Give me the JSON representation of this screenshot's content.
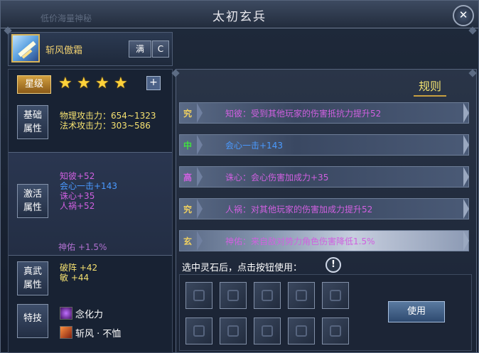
{
  "window": {
    "title": "太初玄兵",
    "watermark": "低价海量神秘"
  },
  "header": {
    "weapon_name": "斩风傲霜",
    "full_label": "满",
    "refresh_symbol": "C"
  },
  "stars": {
    "label": "星级",
    "count": 4,
    "symbol": "★",
    "plus": "+"
  },
  "basic": {
    "tag_line1": "基础",
    "tag_line2": "属性",
    "lines": [
      "物理攻击力：654~1323",
      "法术攻击力：303~586"
    ]
  },
  "activation": {
    "tag_line1": "激活",
    "tag_line2": "属性",
    "lines": [
      {
        "text": "知彼+52",
        "color": "purple"
      },
      {
        "text": "会心一击+143",
        "color": "blue"
      },
      {
        "text": "诛心+35",
        "color": "purple"
      },
      {
        "text": "人祸+52",
        "color": "purple"
      }
    ],
    "shenyou": "神佑 +1.5%"
  },
  "martial": {
    "tag_line1": "真武",
    "tag_line2": "属性",
    "lines": [
      "破阵 +42",
      "敏 +44"
    ]
  },
  "skills": {
    "tag": "特技",
    "items": [
      {
        "name": "念化力",
        "icon": "mind-force-icon"
      },
      {
        "name": "斩风 · 不恤",
        "icon": "wind-slash-icon"
      }
    ]
  },
  "rules": {
    "label": "规则",
    "items": [
      {
        "grade": "究",
        "grade_color": "#f0d060",
        "text": "知彼：受到其他玩家的伤害抵抗力提升52",
        "text_color": "#d060e0"
      },
      {
        "grade": "中",
        "grade_color": "#40e040",
        "text": "会心一击+143",
        "text_color": "#4a9aff"
      },
      {
        "grade": "高",
        "grade_color": "#d060e0",
        "text": "诛心：会心伤害加成力+35",
        "text_color": "#d060e0"
      },
      {
        "grade": "究",
        "grade_color": "#f0d060",
        "text": "人祸：对其他玩家的伤害加成力提升52",
        "text_color": "#d060e0"
      },
      {
        "grade": "玄",
        "grade_color": "#f0d060",
        "text": "神佑：来自敌对势力角色伤害降低1.5%",
        "text_color": "#d060e0"
      }
    ]
  },
  "stones": {
    "hint": "选中灵石后，点击按钮使用：",
    "info_icon": "!",
    "slot_count": 10,
    "use_label": "使用"
  },
  "colors": {
    "accent_gold": "#f0d070",
    "purple": "#d060e0",
    "blue": "#4a9aff"
  }
}
